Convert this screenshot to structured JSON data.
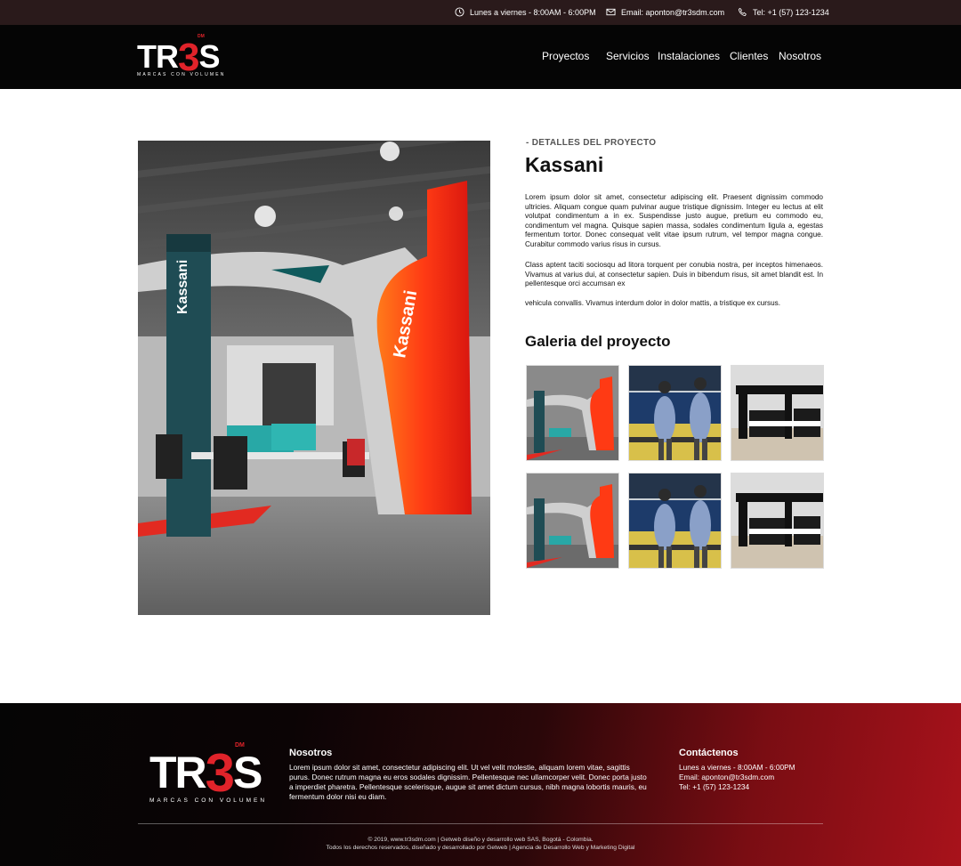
{
  "topbar": {
    "hours": "Lunes a viernes - 8:00AM - 6:00PM",
    "email": "Email: aponton@tr3sdm.com",
    "phone": "Tel: +1 (57) 123-1234"
  },
  "brand": {
    "logo_text_a": "TR",
    "logo_text_b": "3",
    "logo_text_c": "S",
    "logo_dm": "DM",
    "tagline": "MARCAS CON VOLUMEN",
    "accent_color": "#e0232a"
  },
  "nav": {
    "items": [
      {
        "label": "Proyectos"
      },
      {
        "label": "Servicios"
      },
      {
        "label": "Instalaciones"
      },
      {
        "label": "Clientes"
      },
      {
        "label": "Nosotros"
      }
    ]
  },
  "project": {
    "kicker": "-  DETALLES DEL PROYECTO",
    "title": "Kassani",
    "paragraphs": [
      "Lorem ipsum dolor sit amet, consectetur adipiscing elit. Praesent dignissim commodo ultricies. Aliquam congue quam pulvinar augue tristique dignissim. Integer eu lectus at elit volutpat condimentum a in ex. Suspendisse justo augue, pretium eu commodo eu, condimentum vel magna. Quisque sapien massa, sodales condimentum ligula a, egestas fermentum tortor. Donec consequat velit vitae ipsum rutrum, vel tempor magna congue. Curabitur commodo varius risus in cursus.",
      "Class aptent taciti sociosqu ad litora torquent per conubia nostra, per inceptos himenaeos. Vivamus at varius dui, at consectetur sapien. Duis in bibendum risus, sit amet blandit est. In pellentesque orci accumsan ex",
      "vehicula convallis. Vivamus interdum dolor in dolor mattis, a tristique ex cursus."
    ],
    "booth_sign": "Kassani"
  },
  "gallery": {
    "title": "Galeria del proyecto"
  },
  "footer": {
    "about_title": "Nosotros",
    "about_text": "Lorem ipsum dolor sit amet, consectetur adipiscing elit. Ut vel velit molestie, aliquam lorem vitae, sagittis purus. Donec rutrum magna eu eros sodales dignissim. Pellentesque nec ullamcorper velit. Donec porta justo a imperdiet pharetra. Pellentesque scelerisque, augue sit amet dictum cursus, nibh magna lobortis mauris, eu fermentum dolor nisi eu diam.",
    "contact_title": "Contáctenos",
    "contact_hours": "Lunes a viernes - 8:00AM - 6:00PM",
    "contact_email": "Email: aponton@tr3sdm.com",
    "contact_phone": "Tel: +1 (57) 123-1234",
    "copyright_1": "© 2019, www.tr3sdm.com | Getweb diseño y desarrollo web SAS, Bogotá - Colombia.",
    "copyright_2": "Todos los derechos reservados, diseñado y desarrollado por Getweb | Agencia de Desarrollo Web y Marketing Digital"
  },
  "icons": {
    "hours": "clock-icon",
    "email": "envelope-icon",
    "phone": "phone-icon"
  }
}
